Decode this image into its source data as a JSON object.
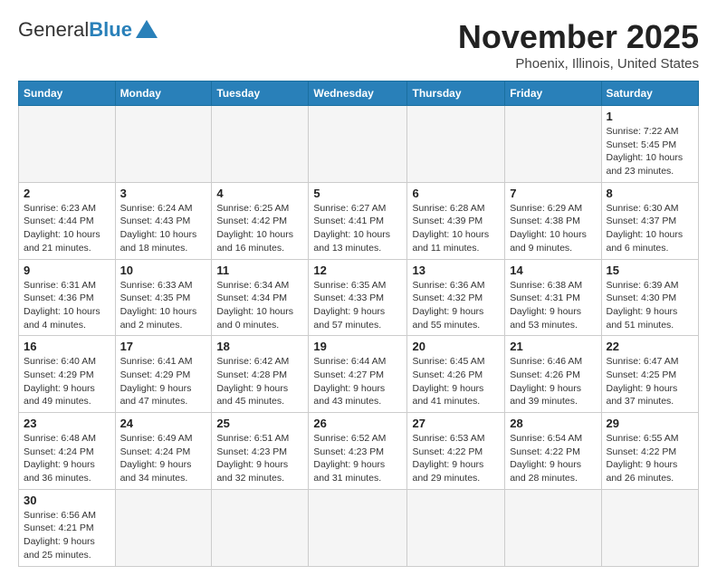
{
  "header": {
    "logo_general": "General",
    "logo_blue": "Blue",
    "month": "November 2025",
    "location": "Phoenix, Illinois, United States"
  },
  "weekdays": [
    "Sunday",
    "Monday",
    "Tuesday",
    "Wednesday",
    "Thursday",
    "Friday",
    "Saturday"
  ],
  "weeks": [
    [
      {
        "day": "",
        "info": ""
      },
      {
        "day": "",
        "info": ""
      },
      {
        "day": "",
        "info": ""
      },
      {
        "day": "",
        "info": ""
      },
      {
        "day": "",
        "info": ""
      },
      {
        "day": "",
        "info": ""
      },
      {
        "day": "1",
        "info": "Sunrise: 7:22 AM\nSunset: 5:45 PM\nDaylight: 10 hours and 23 minutes."
      }
    ],
    [
      {
        "day": "2",
        "info": "Sunrise: 6:23 AM\nSunset: 4:44 PM\nDaylight: 10 hours and 21 minutes."
      },
      {
        "day": "3",
        "info": "Sunrise: 6:24 AM\nSunset: 4:43 PM\nDaylight: 10 hours and 18 minutes."
      },
      {
        "day": "4",
        "info": "Sunrise: 6:25 AM\nSunset: 4:42 PM\nDaylight: 10 hours and 16 minutes."
      },
      {
        "day": "5",
        "info": "Sunrise: 6:27 AM\nSunset: 4:41 PM\nDaylight: 10 hours and 13 minutes."
      },
      {
        "day": "6",
        "info": "Sunrise: 6:28 AM\nSunset: 4:39 PM\nDaylight: 10 hours and 11 minutes."
      },
      {
        "day": "7",
        "info": "Sunrise: 6:29 AM\nSunset: 4:38 PM\nDaylight: 10 hours and 9 minutes."
      },
      {
        "day": "8",
        "info": "Sunrise: 6:30 AM\nSunset: 4:37 PM\nDaylight: 10 hours and 6 minutes."
      }
    ],
    [
      {
        "day": "9",
        "info": "Sunrise: 6:31 AM\nSunset: 4:36 PM\nDaylight: 10 hours and 4 minutes."
      },
      {
        "day": "10",
        "info": "Sunrise: 6:33 AM\nSunset: 4:35 PM\nDaylight: 10 hours and 2 minutes."
      },
      {
        "day": "11",
        "info": "Sunrise: 6:34 AM\nSunset: 4:34 PM\nDaylight: 10 hours and 0 minutes."
      },
      {
        "day": "12",
        "info": "Sunrise: 6:35 AM\nSunset: 4:33 PM\nDaylight: 9 hours and 57 minutes."
      },
      {
        "day": "13",
        "info": "Sunrise: 6:36 AM\nSunset: 4:32 PM\nDaylight: 9 hours and 55 minutes."
      },
      {
        "day": "14",
        "info": "Sunrise: 6:38 AM\nSunset: 4:31 PM\nDaylight: 9 hours and 53 minutes."
      },
      {
        "day": "15",
        "info": "Sunrise: 6:39 AM\nSunset: 4:30 PM\nDaylight: 9 hours and 51 minutes."
      }
    ],
    [
      {
        "day": "16",
        "info": "Sunrise: 6:40 AM\nSunset: 4:29 PM\nDaylight: 9 hours and 49 minutes."
      },
      {
        "day": "17",
        "info": "Sunrise: 6:41 AM\nSunset: 4:29 PM\nDaylight: 9 hours and 47 minutes."
      },
      {
        "day": "18",
        "info": "Sunrise: 6:42 AM\nSunset: 4:28 PM\nDaylight: 9 hours and 45 minutes."
      },
      {
        "day": "19",
        "info": "Sunrise: 6:44 AM\nSunset: 4:27 PM\nDaylight: 9 hours and 43 minutes."
      },
      {
        "day": "20",
        "info": "Sunrise: 6:45 AM\nSunset: 4:26 PM\nDaylight: 9 hours and 41 minutes."
      },
      {
        "day": "21",
        "info": "Sunrise: 6:46 AM\nSunset: 4:26 PM\nDaylight: 9 hours and 39 minutes."
      },
      {
        "day": "22",
        "info": "Sunrise: 6:47 AM\nSunset: 4:25 PM\nDaylight: 9 hours and 37 minutes."
      }
    ],
    [
      {
        "day": "23",
        "info": "Sunrise: 6:48 AM\nSunset: 4:24 PM\nDaylight: 9 hours and 36 minutes."
      },
      {
        "day": "24",
        "info": "Sunrise: 6:49 AM\nSunset: 4:24 PM\nDaylight: 9 hours and 34 minutes."
      },
      {
        "day": "25",
        "info": "Sunrise: 6:51 AM\nSunset: 4:23 PM\nDaylight: 9 hours and 32 minutes."
      },
      {
        "day": "26",
        "info": "Sunrise: 6:52 AM\nSunset: 4:23 PM\nDaylight: 9 hours and 31 minutes."
      },
      {
        "day": "27",
        "info": "Sunrise: 6:53 AM\nSunset: 4:22 PM\nDaylight: 9 hours and 29 minutes."
      },
      {
        "day": "28",
        "info": "Sunrise: 6:54 AM\nSunset: 4:22 PM\nDaylight: 9 hours and 28 minutes."
      },
      {
        "day": "29",
        "info": "Sunrise: 6:55 AM\nSunset: 4:22 PM\nDaylight: 9 hours and 26 minutes."
      }
    ],
    [
      {
        "day": "30",
        "info": "Sunrise: 6:56 AM\nSunset: 4:21 PM\nDaylight: 9 hours and 25 minutes."
      },
      {
        "day": "",
        "info": ""
      },
      {
        "day": "",
        "info": ""
      },
      {
        "day": "",
        "info": ""
      },
      {
        "day": "",
        "info": ""
      },
      {
        "day": "",
        "info": ""
      },
      {
        "day": "",
        "info": ""
      }
    ]
  ]
}
